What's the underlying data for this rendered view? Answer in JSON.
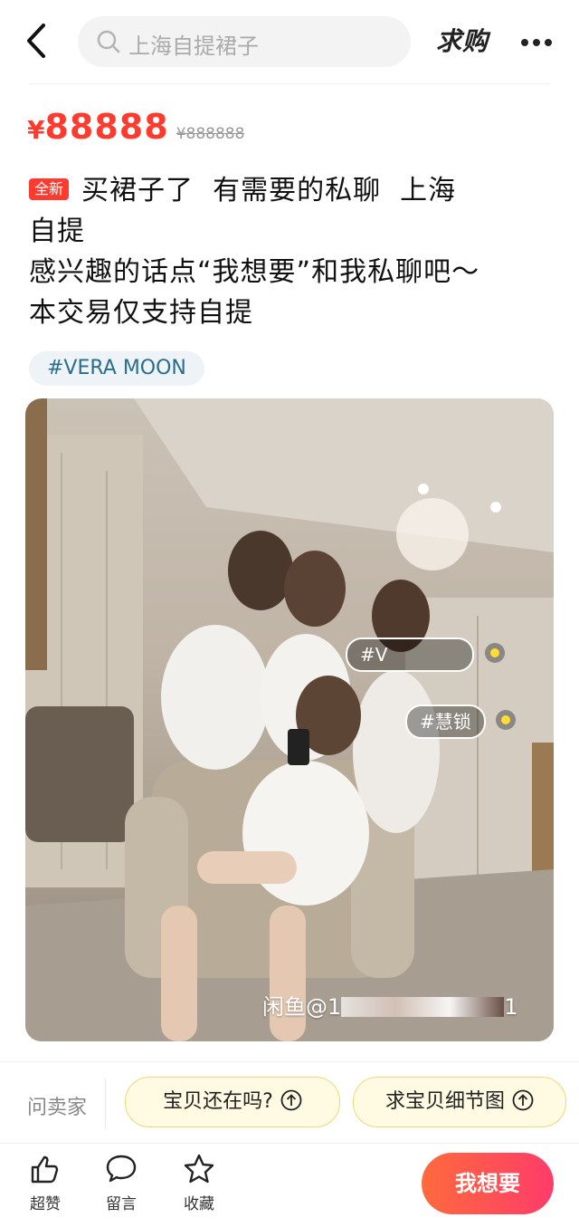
{
  "header": {
    "search_placeholder": "上海自提裙子",
    "qiugou_label": "求购"
  },
  "price": {
    "currency": "¥",
    "value": "88888",
    "original": "¥888888"
  },
  "listing": {
    "badge": "全新",
    "title_lines": [
      "买裙子了  有需要的私聊  上海",
      "自提",
      "感兴趣的话点“我想要”和我私聊吧～",
      "本交易仅支持自提"
    ],
    "tag": "#VERA MOON"
  },
  "photo": {
    "tags": [
      "#V",
      "#慧锁"
    ],
    "watermark": "闲鱼@1",
    "watermark_tail": "1"
  },
  "ask": {
    "label": "问卖家",
    "chips": [
      "宝贝还在吗?",
      "求宝贝细节图"
    ]
  },
  "bottom": {
    "like_label": "超赞",
    "comment_label": "留言",
    "fav_label": "收藏",
    "want_label": "我想要"
  },
  "colors": {
    "price_red": "#ff3b30",
    "tag_text": "#2b6d8c",
    "chip_border": "#f0d77a",
    "want_gradient_start": "#ff6a3d",
    "want_gradient_end": "#ff3c6a"
  }
}
